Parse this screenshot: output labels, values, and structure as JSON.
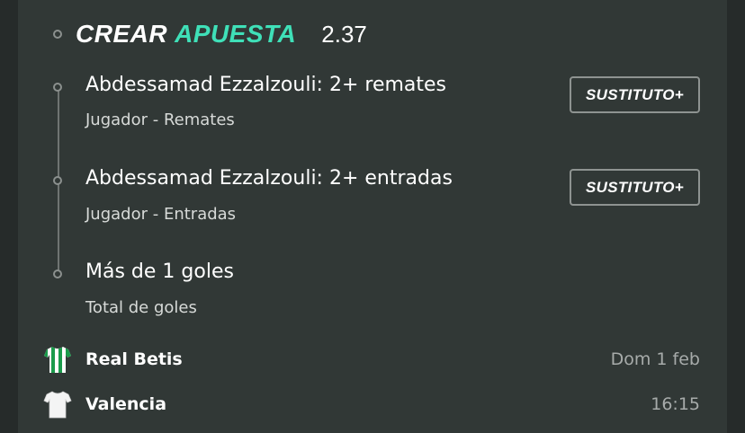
{
  "header": {
    "title_part1": "CREAR",
    "title_part2": "APUESTA",
    "odds": "2.37",
    "accent_color": "#3fe0b8"
  },
  "selections": [
    {
      "title": "Abdessamad Ezzalzouli: 2+ remates",
      "subtitle": "Jugador - Remates",
      "action_label": "SUSTITUTO+"
    },
    {
      "title": "Abdessamad Ezzalzouli: 2+ entradas",
      "subtitle": "Jugador - Entradas",
      "action_label": "SUSTITUTO+"
    },
    {
      "title": "Más de 1 goles",
      "subtitle": "Total de goles"
    }
  ],
  "match": {
    "home": {
      "name": "Real Betis",
      "icon": "green-white-striped-jersey-icon",
      "meta": "Dom 1 feb"
    },
    "away": {
      "name": "Valencia",
      "icon": "white-jersey-icon",
      "meta": "16:15"
    }
  }
}
